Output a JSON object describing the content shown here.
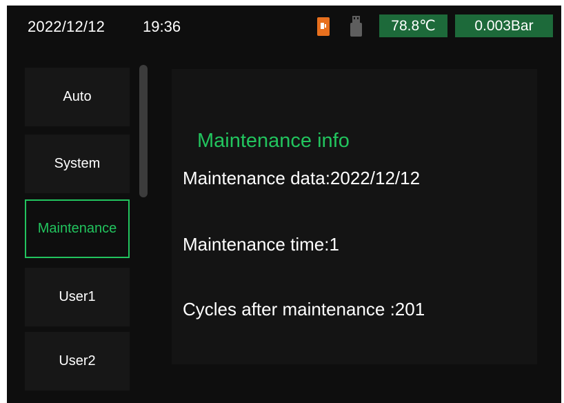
{
  "status_bar": {
    "date": "2022/12/12",
    "time": "19:36",
    "door_icon": "door-icon",
    "usb_icon": "usb-icon",
    "temperature": "78.8℃",
    "pressure": "0.003Bar",
    "badge_color": "#1d6a3a",
    "door_icon_color": "#e8701e"
  },
  "menu": {
    "items": [
      {
        "label": "Auto"
      },
      {
        "label": "System"
      },
      {
        "label": "Maintenance"
      },
      {
        "label": "User1"
      },
      {
        "label": "User2"
      }
    ],
    "active_index": 2,
    "active_color": "#22c45e"
  },
  "panel": {
    "title": "Maintenance info",
    "lines": [
      "Maintenance data:2022/12/12",
      "Maintenance time:1",
      "Cycles after maintenance :201"
    ]
  }
}
